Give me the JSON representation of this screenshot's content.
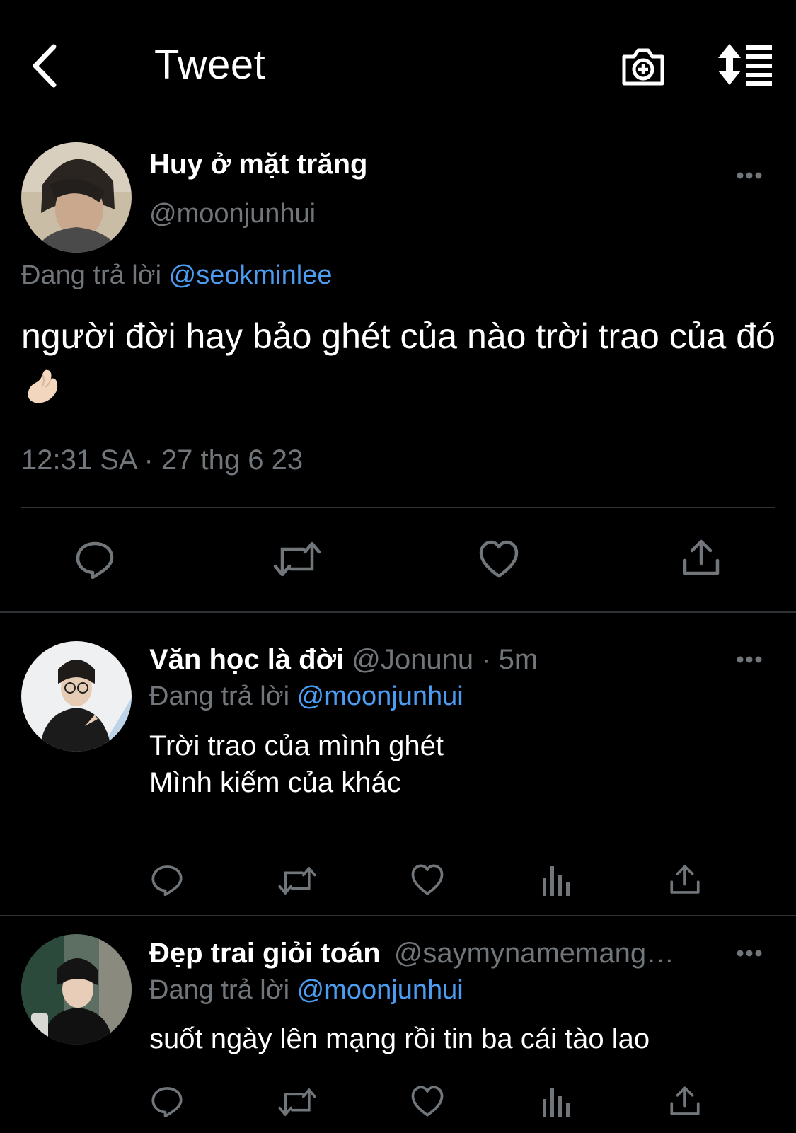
{
  "header": {
    "title": "Tweet",
    "back_icon": "chevron-left-icon",
    "camera_icon": "camera-plus-icon",
    "sort_icon": "sort-list-icon"
  },
  "main_tweet": {
    "display_name": "Huy ở mặt trăng",
    "handle": "@moonjunhui",
    "replying_prefix": "Đang trả lời",
    "replying_to": "@seokminlee",
    "text": "người đời hay bảo ghét của nào trời trao của đó",
    "emoji": "pinching-hand-emoji",
    "timestamp": "12:31 SA · 27 thg 6 23"
  },
  "replies": [
    {
      "display_name": "Văn học là đời",
      "handle": "@Jonunu",
      "time": "· 5m",
      "replying_prefix": "Đang trả lời",
      "replying_to": "@moonjunhui",
      "text": "Trời trao của mình ghét\nMình kiếm của khác"
    },
    {
      "display_name": "Đẹp trai giỏi toán",
      "handle": "@saymynamemang…",
      "time": "",
      "replying_prefix": "Đang trả lời",
      "replying_to": "@moonjunhui",
      "text": "suốt ngày lên mạng rồi tin ba cái tào lao"
    }
  ],
  "colors": {
    "background": "#000000",
    "text": "#e7e9ea",
    "muted": "#71767b",
    "link": "#4c9df1",
    "divider": "#2f3336"
  }
}
